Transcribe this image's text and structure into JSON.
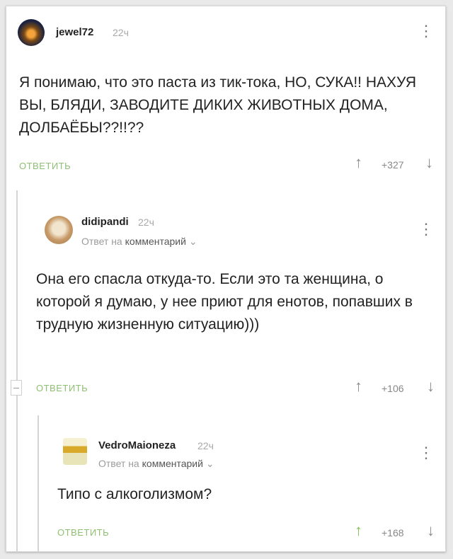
{
  "comments": [
    {
      "username": "jewel72",
      "time": "22ч",
      "text": "Я понимаю, что это паста из тик-тока, НО, СУКА!! НАХУЯ ВЫ, БЛЯДИ, ЗАВОДИТЕ ДИКИХ ЖИВОТНЫХ ДОМА, ДОЛБАЁБЫ??!!??",
      "reply_label": "ОТВЕТИТЬ",
      "score": "+327"
    },
    {
      "username": "didipandi",
      "time": "22ч",
      "reply_prefix": "Ответ на",
      "reply_target": "комментарий",
      "text": "Она его спасла откуда-то. Если это та женщина, о которой я думаю, у нее приют для енотов, попавших в трудную жизненную ситуацию)))",
      "reply_label": "ОТВЕТИТЬ",
      "score": "+106"
    },
    {
      "username": "VedroMaioneza",
      "time": "22ч",
      "reply_prefix": "Ответ на",
      "reply_target": "комментарий",
      "text": "Типо с алкоголизмом?",
      "reply_label": "ОТВЕТИТЬ",
      "score": "+168"
    }
  ],
  "icons": {
    "more": "⋮",
    "upvote": "↑",
    "downvote": "↓",
    "chevron": "⌄"
  },
  "colors": {
    "reply_green": "#8fbf72",
    "upvote_active": "#7fc150"
  }
}
